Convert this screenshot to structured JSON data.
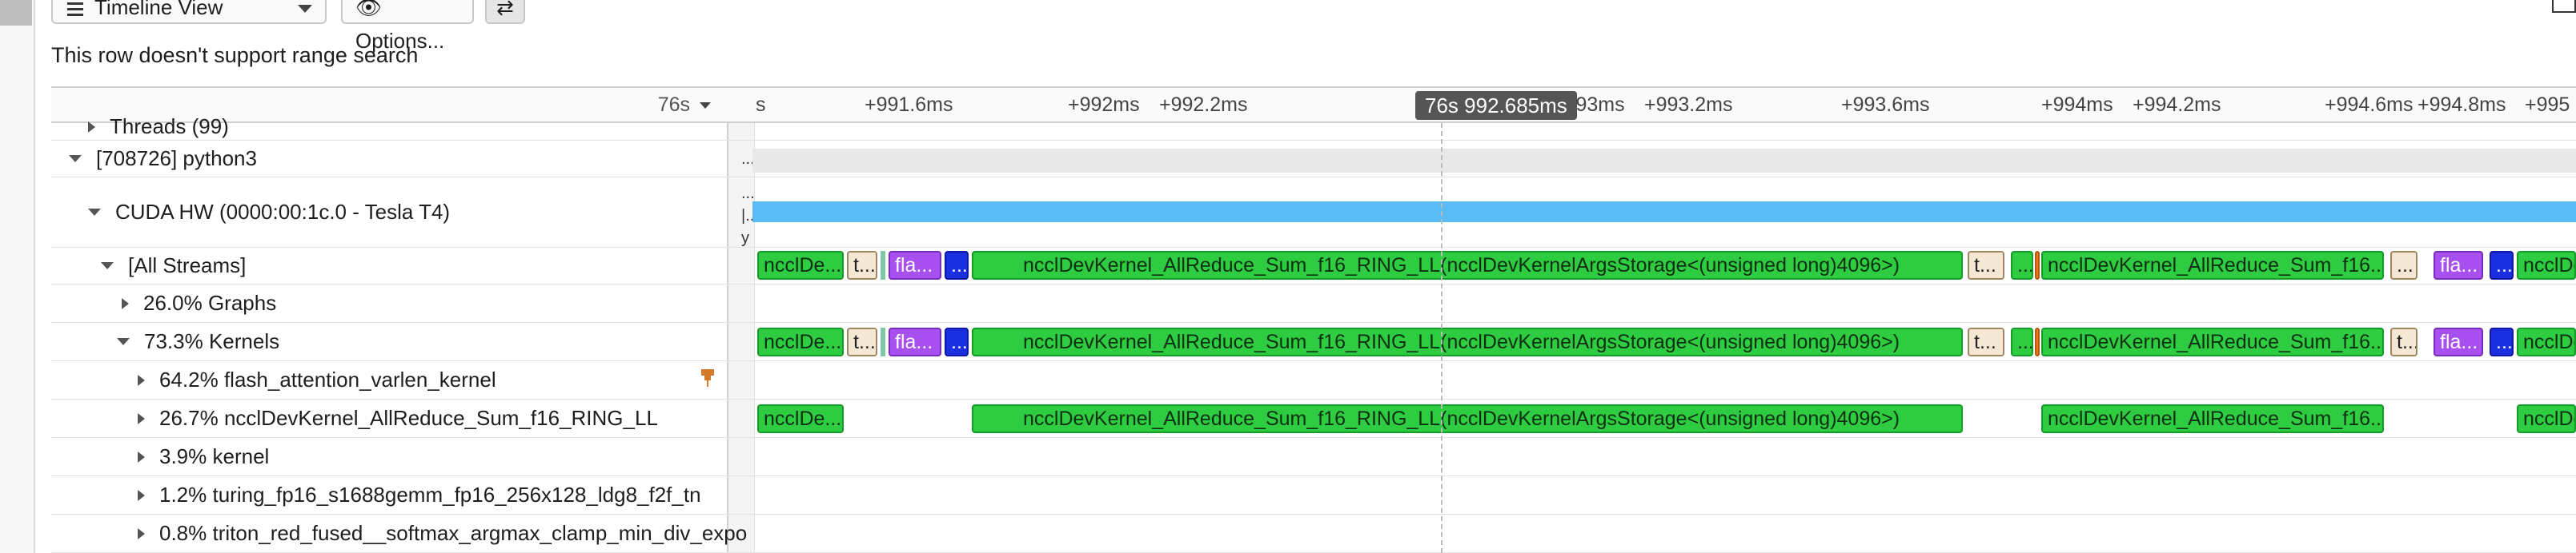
{
  "toolbar": {
    "view_label": "Timeline View",
    "options_label": "Options...",
    "swap_label": "⇄"
  },
  "notice": "This row doesn't support range search",
  "timeline_header": {
    "time_select": "76s",
    "ticks": [
      "s",
      "+991.6ms",
      "+992ms",
      "+992.2ms",
      "+993ms",
      "+993.2ms",
      "+993.6ms",
      "+994ms",
      "+994.2ms",
      "+994.6ms",
      "+994.8ms",
      "+995"
    ],
    "cursor_label": "76s 992.685ms"
  },
  "rows": [
    {
      "label": "Threads (99)",
      "expanded": false,
      "indent": 1
    },
    {
      "label": "[708726] python3",
      "expanded": true,
      "indent": 0,
      "tail": "..."
    },
    {
      "label": "CUDA HW (0000:00:1c.0 - Tesla T4)",
      "expanded": true,
      "indent": 1,
      "tail": "...|...y"
    },
    {
      "label": "[All Streams]",
      "expanded": true,
      "indent": 2
    },
    {
      "label": "26.0% Graphs",
      "expanded": false,
      "indent": 3
    },
    {
      "label": "73.3% Kernels",
      "expanded": true,
      "indent": 3
    },
    {
      "label": "64.2% flash_attention_varlen_kernel",
      "expanded": false,
      "indent": 4,
      "pinned": true
    },
    {
      "label": "26.7% ncclDevKernel_AllReduce_Sum_f16_RING_LL",
      "expanded": false,
      "indent": 4
    },
    {
      "label": "3.9% kernel",
      "expanded": false,
      "indent": 4
    },
    {
      "label": "1.2% turing_fp16_s1688gemm_fp16_256x128_ldg8_f2f_tn",
      "expanded": false,
      "indent": 4
    },
    {
      "label": "0.8% triton_red_fused__softmax_argmax_clamp_min_div_expo",
      "expanded": false,
      "indent": 4
    }
  ],
  "blocks": {
    "nccl_short": "ncclDe...",
    "t_short": "t...",
    "fla_short": "fla...",
    "dots": "...",
    "nccl_full": "ncclDevKernel_AllReduce_Sum_f16_RING_LL(ncclDevKernelArgsStorage<(unsigned long)4096>)",
    "nccl_mid": "ncclDevKernel_AllReduce_Sum_f16...",
    "nccl_edge": "ncclDe"
  },
  "colors": {
    "kernel_green": "#2ecc40",
    "flash_purple": "#a84ff0",
    "blue_kernel": "#1a2fe0",
    "hw_bar": "#5bbcf5"
  }
}
